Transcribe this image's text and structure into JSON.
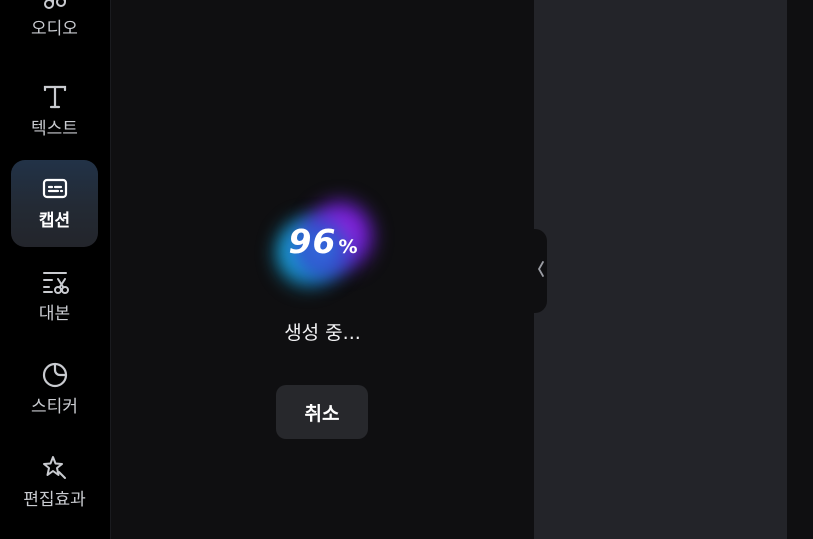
{
  "sidebar": {
    "items": [
      {
        "label": "오디오",
        "icon": "music-note-icon"
      },
      {
        "label": "텍스트",
        "icon": "text-t-icon"
      },
      {
        "label": "캡션",
        "icon": "caption-icon",
        "active": true
      },
      {
        "label": "대본",
        "icon": "script-scissors-icon"
      },
      {
        "label": "스티커",
        "icon": "sticker-icon"
      },
      {
        "label": "편집효과",
        "icon": "sparkle-effects-icon"
      }
    ]
  },
  "progress": {
    "value": "96",
    "unit": "%",
    "status": "생성 중..."
  },
  "cancel_label": "취소",
  "colors": {
    "sidebar_bg": "#000000",
    "center_bg": "#0f0f11",
    "right_panel_bg": "#232429",
    "active_item_bg": "#223247",
    "button_bg": "#27282c",
    "orb_cyan": "#21d4e8",
    "orb_purple": "#b21fe0"
  }
}
